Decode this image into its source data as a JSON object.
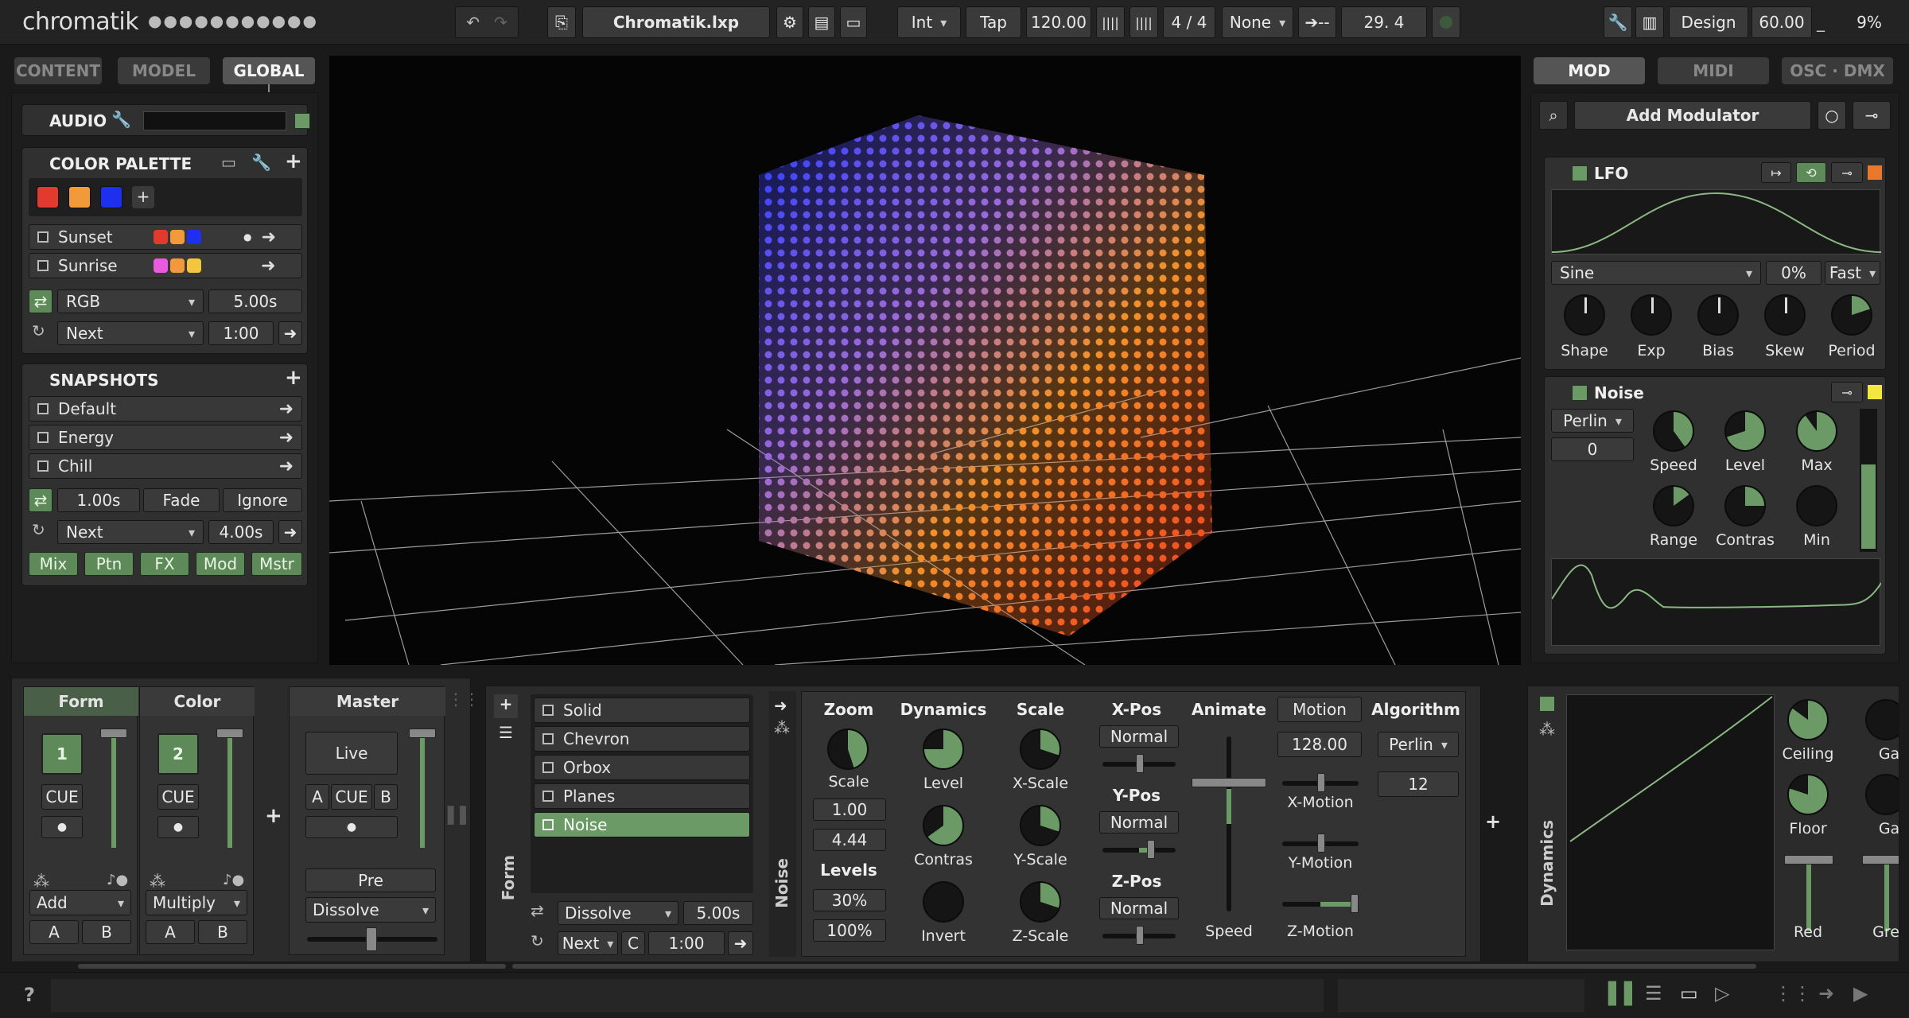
{
  "app": {
    "name": "chromatik",
    "dots": "●●●●●●●●●●●"
  },
  "toolbar": {
    "project": "Chromatik.lxp",
    "clock_mode": "Int",
    "tap": "Tap",
    "bpm": "120.00",
    "meter": "4 / 4",
    "sync": "None",
    "arrow_label": "➔--",
    "beat_count": "29. 4",
    "view_mode": "Design",
    "fps": "60.00",
    "cpu": "9%"
  },
  "left_tabs": [
    "CONTENT",
    "MODEL",
    "GLOBAL"
  ],
  "audio": {
    "title": "AUDIO"
  },
  "palette": {
    "title": "COLOR PALETTE",
    "swatches": [
      "#e23a2e",
      "#f29a3a",
      "#1f2ff0"
    ],
    "items": [
      {
        "name": "Sunset",
        "colors": [
          "#e23a2e",
          "#f29a3a",
          "#1f2ff0"
        ]
      },
      {
        "name": "Sunrise",
        "colors": [
          "#e85ae0",
          "#f29a3a",
          "#f4c640"
        ]
      }
    ],
    "blend": "RGB",
    "blend_time": "5.00s",
    "cycle": "Next",
    "cycle_time": "1:00"
  },
  "snapshots": {
    "title": "SNAPSHOTS",
    "items": [
      "Default",
      "Energy",
      "Chill"
    ],
    "transition_time": "1.00s",
    "fade": "Fade",
    "ignore": "Ignore",
    "cycle": "Next",
    "cycle_time": "4.00s",
    "scopes": [
      "Mix",
      "Ptn",
      "FX",
      "Mod",
      "Mstr"
    ]
  },
  "right_tabs": [
    "MOD",
    "MIDI",
    "OSC · DMX"
  ],
  "modulators": {
    "add_label": "Add Modulator",
    "lfo": {
      "title": "LFO",
      "wave": "Sine",
      "phase": "0%",
      "rate": "Fast",
      "knobs": [
        "Shape",
        "Exp",
        "Bias",
        "Skew",
        "Period"
      ],
      "color": "#e8782a"
    },
    "noise": {
      "title": "Noise",
      "algo": "Perlin",
      "seed": "0",
      "knobs_top": [
        "Speed",
        "Level",
        "Max"
      ],
      "knobs_bottom": [
        "Range",
        "Contras",
        "Min"
      ],
      "color": "#f4e640"
    }
  },
  "mixer": {
    "channels": [
      {
        "name": "Form",
        "number": "1",
        "cue": "CUE",
        "blend": "Add",
        "a": "A",
        "b": "B"
      },
      {
        "name": "Color",
        "number": "2",
        "cue": "CUE",
        "blend": "Multiply",
        "a": "A",
        "b": "B"
      }
    ],
    "master": {
      "name": "Master",
      "live": "Live",
      "a": "A",
      "cue": "CUE",
      "b": "B",
      "pre": "Pre",
      "transition": "Dissolve"
    }
  },
  "patterns": {
    "channel": "Form",
    "items": [
      "Solid",
      "Chevron",
      "Orbox",
      "Planes",
      "Noise"
    ],
    "selected": 4,
    "transition": "Dissolve",
    "transition_time": "5.00s",
    "cycle": "Next",
    "cue": "C",
    "cycle_time": "1:00"
  },
  "device": {
    "label": "Noise",
    "zoom": {
      "head": "Zoom",
      "knob": "Scale",
      "v1": "1.00",
      "v2": "4.44",
      "levels_head": "Levels",
      "l1": "30%",
      "l2": "100%"
    },
    "dynamics": {
      "head": "Dynamics",
      "knobs": [
        "Level",
        "Contras",
        "Invert"
      ]
    },
    "scale": {
      "head": "Scale",
      "knobs": [
        "X-Scale",
        "Y-Scale",
        "Z-Scale"
      ]
    },
    "pos": {
      "x_head": "X-Pos",
      "x": "Normal",
      "y_head": "Y-Pos",
      "y": "Normal",
      "z_head": "Z-Pos",
      "z": "Normal"
    },
    "animate": {
      "head": "Animate",
      "speed": "Speed"
    },
    "motion": {
      "head": "Motion",
      "value": "128.00",
      "x": "X-Motion",
      "y": "Y-Motion",
      "z": "Z-Motion"
    },
    "algorithm": {
      "head": "Algorithm",
      "value": "Perlin",
      "octaves": "12"
    }
  },
  "fx": {
    "label": "Dynamics",
    "knobs": [
      "Ceiling",
      "Floor"
    ],
    "faders": [
      "Red",
      "Gre"
    ],
    "partial": [
      "Ga",
      "Ga"
    ]
  },
  "status": {
    "help": "?"
  }
}
